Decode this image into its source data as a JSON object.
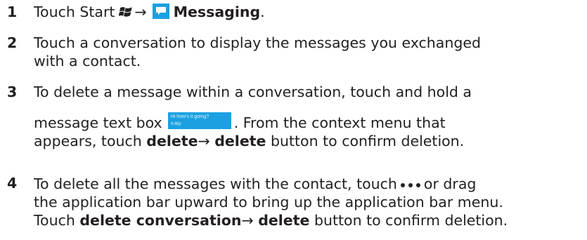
{
  "steps": [
    {
      "number": "1",
      "lines": {
        "pre": "Touch Start",
        "arrow": "→",
        "app_name": "Messaging",
        "post": "."
      }
    },
    {
      "number": "2",
      "lines": [
        "Touch a conversation to display the messages you exchanged",
        "with a contact."
      ]
    },
    {
      "number": "3",
      "line1": "To delete a message within a conversation, touch and hold a",
      "line2_pre": "message text box",
      "line2_post": ". From the context menu that",
      "line3_pre": "appears, touch",
      "bold_1": "delete",
      "arrow": "→",
      "bold_2": "delete",
      "line3_post": "button to confirm deletion.",
      "message_box": {
        "text": "Hi how's it going?",
        "time": "4:46p"
      }
    },
    {
      "number": "4",
      "line1_pre": "To delete all the messages with the contact, touch",
      "line1_post": "or drag",
      "line2": "the application bar upward to bring up the application bar menu.",
      "line3_pre": "Touch",
      "bold_1": "delete conversation",
      "arrow": "→",
      "bold_2": "delete",
      "line3_post": "button to confirm deletion."
    }
  ],
  "icons": {
    "start": "windows-logo-icon",
    "messaging": "messaging-icon",
    "more": "ellipsis-icon"
  },
  "colors": {
    "text": "#231f20",
    "accent": "#1ba1e2"
  }
}
